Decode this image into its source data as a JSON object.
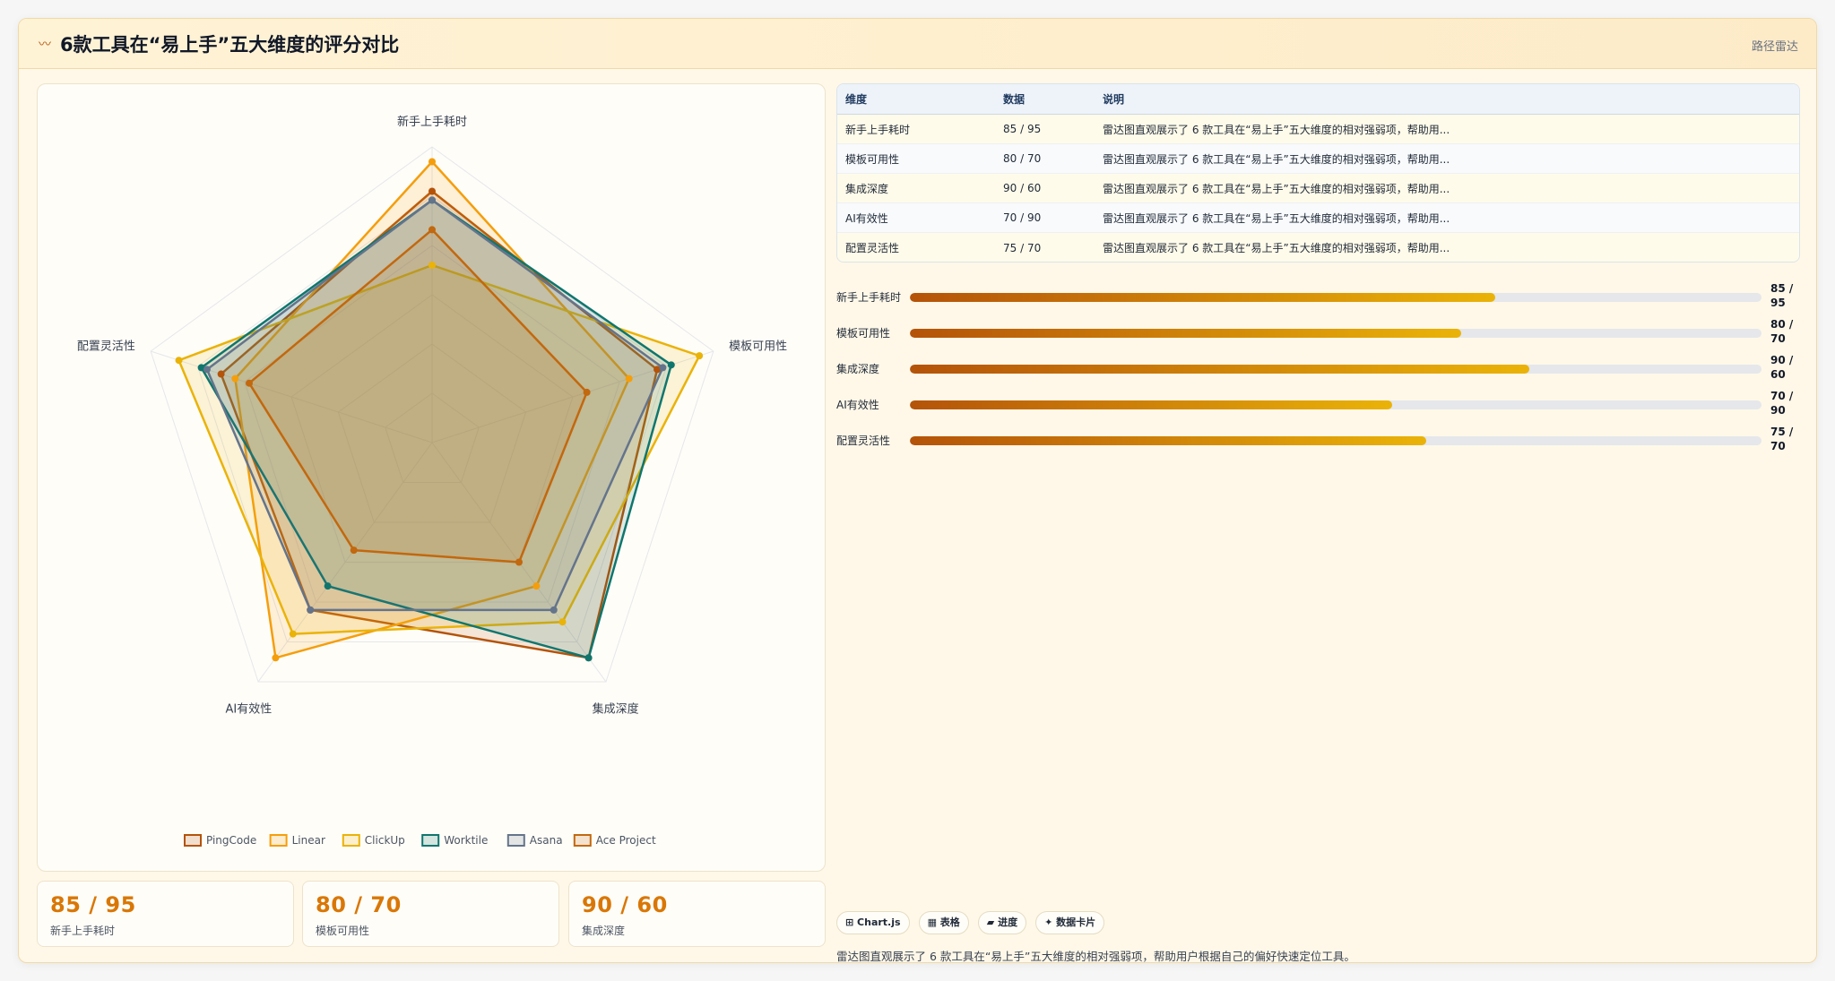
{
  "header": {
    "icon": "〰",
    "title": "6款工具在“易上手”五大维度的评分对比",
    "tag": "路径雷达"
  },
  "colors": {
    "PingCode": "#b45309",
    "Linear": "#f59e0b",
    "ClickUp": "#eab308",
    "Worktile": "#0f766e",
    "Asana": "#64748b",
    "AceProject": "#c2680e",
    "accent": "#d97706"
  },
  "chart_data": {
    "type": "radar",
    "axes": [
      "新手上手耗时",
      "模板可用性",
      "集成深度",
      "AI有效性",
      "配置灵活性"
    ],
    "range": [
      0,
      100
    ],
    "grid": true,
    "legend_position": "bottom",
    "series": [
      {
        "name": "PingCode",
        "values": [
          85,
          80,
          90,
          70,
          75
        ]
      },
      {
        "name": "Linear",
        "values": [
          95,
          70,
          60,
          90,
          70
        ]
      },
      {
        "name": "ClickUp",
        "values": [
          60,
          95,
          75,
          80,
          90
        ]
      },
      {
        "name": "Worktile",
        "values": [
          82,
          85,
          90,
          60,
          82
        ]
      },
      {
        "name": "Asana",
        "values": [
          82,
          82,
          70,
          70,
          80
        ]
      },
      {
        "name": "Ace Project",
        "values": [
          72,
          55,
          50,
          45,
          65
        ]
      }
    ]
  },
  "table": {
    "headers": [
      "维度",
      "数据",
      "说明"
    ],
    "rows": [
      [
        "新手上手耗时",
        "85 / 95",
        "雷达图直观展示了 6 款工具在“易上手”五大维度的相对强弱项，帮助用..."
      ],
      [
        "模板可用性",
        "80 / 70",
        "雷达图直观展示了 6 款工具在“易上手”五大维度的相对强弱项，帮助用..."
      ],
      [
        "集成深度",
        "90 / 60",
        "雷达图直观展示了 6 款工具在“易上手”五大维度的相对强弱项，帮助用..."
      ],
      [
        "AI有效性",
        "70 / 90",
        "雷达图直观展示了 6 款工具在“易上手”五大维度的相对强弱项，帮助用..."
      ],
      [
        "配置灵活性",
        "75 / 70",
        "雷达图直观展示了 6 款工具在“易上手”五大维度的相对强弱项，帮助用..."
      ]
    ]
  },
  "bars": [
    {
      "label": "新手上手耗时",
      "value": "85 / 95",
      "fraction": 0.687
    },
    {
      "label": "模板可用性",
      "value": "80 / 70",
      "fraction": 0.647
    },
    {
      "label": "集成深度",
      "value": "90 / 60",
      "fraction": 0.727
    },
    {
      "label": "AI有效性",
      "value": "70 / 90",
      "fraction": 0.566
    },
    {
      "label": "配置灵活性",
      "value": "75 / 70",
      "fraction": 0.606
    }
  ],
  "stats": [
    {
      "value": "85 / 95",
      "label": "新手上手耗时"
    },
    {
      "value": "80 / 70",
      "label": "模板可用性"
    },
    {
      "value": "90 / 60",
      "label": "集成深度"
    }
  ],
  "chips": [
    "⊞ Chart.js",
    "▦ 表格",
    "▰ 进度",
    "✦ 数据卡片"
  ],
  "footnote": "雷达图直观展示了 6 款工具在“易上手”五大维度的相对强弱项，帮助用户根据自己的偏好快速定位工具。"
}
